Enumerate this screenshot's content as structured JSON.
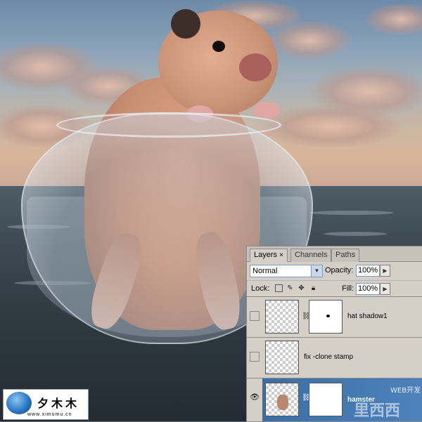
{
  "panel": {
    "tabs": [
      {
        "label": "Layers",
        "close": "×",
        "active": true
      },
      {
        "label": "Channels",
        "active": false
      },
      {
        "label": "Paths",
        "active": false
      }
    ],
    "blend_mode": "Normal",
    "opacity_label": "Opacity:",
    "opacity_value": "100%",
    "lock_label": "Lock:",
    "fill_label": "Fill:",
    "fill_value": "100%",
    "layers": [
      {
        "name": "hat shadow1",
        "visible": false,
        "has_mask": true,
        "selected": false
      },
      {
        "name": "fix -clone stamp",
        "visible": false,
        "has_mask": false,
        "selected": false
      },
      {
        "name": "hamster",
        "visible": true,
        "has_mask": true,
        "selected": true
      }
    ]
  },
  "watermark": {
    "web_text": "WEB开发",
    "cn_text": "里西西"
  },
  "logo": {
    "chars": "夕木木",
    "url": "www.ximumu.cn"
  },
  "icons": {
    "dropdown": "triangle-down-icon",
    "arrow": "triangle-right-icon",
    "eye": "eye-icon",
    "chain": "chain-link-icon"
  },
  "colors": {
    "panel_bg": "#d4d0c8",
    "selected_row": "#3a6ea5"
  }
}
